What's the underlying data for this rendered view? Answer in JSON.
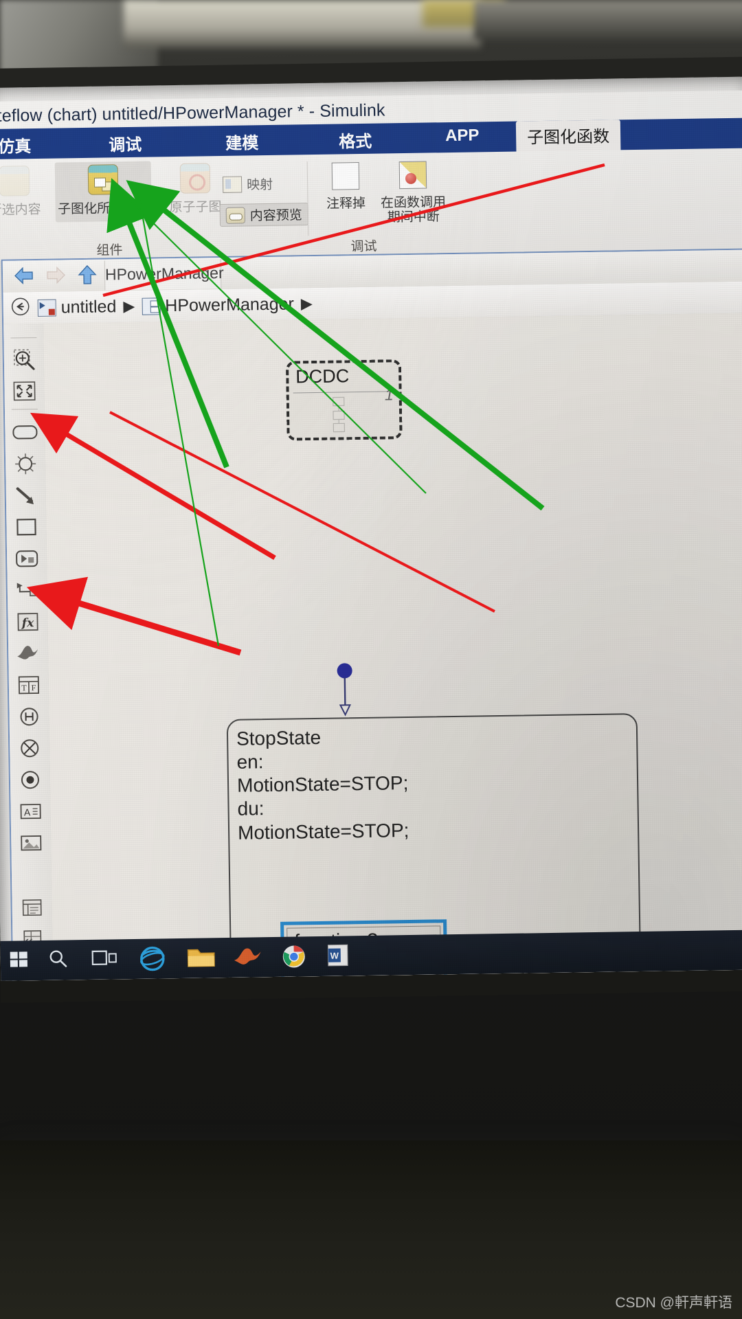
{
  "window": {
    "title": "tateflow (chart) untitled/HPowerManager * - Simulink"
  },
  "ribbon": {
    "tabs": [
      {
        "label": "仿真",
        "active": false
      },
      {
        "label": "调试",
        "active": false
      },
      {
        "label": "建模",
        "active": false
      },
      {
        "label": "格式",
        "active": false
      },
      {
        "label": "APP",
        "active": false
      },
      {
        "label": "子图化函数",
        "active": true
      }
    ],
    "buttons": {
      "uncompose_selected": "所选内容",
      "subchart_selected": "子图化所选内容",
      "atomic_subchart": "原子子图",
      "map": "映射",
      "content_preview": "内容预览",
      "comment_out": "注释掉",
      "break_on_call_l1": "在函数调用",
      "break_on_call_l2": "期间中断"
    },
    "groups": {
      "component": "组件",
      "debug": "调试"
    }
  },
  "model_window": {
    "file_tab": "HPowerManager",
    "breadcrumb": [
      {
        "label": "untitled",
        "icon": "model-icon"
      },
      {
        "label": "HPowerManager",
        "icon": "chart-icon"
      }
    ],
    "breadcrumb_separator": "▶",
    "nav": {
      "back": "back-arrow",
      "forward": "forward-arrow",
      "up": "up-arrow"
    }
  },
  "palette": {
    "items": [
      {
        "name": "zoom-tool",
        "icon": "magnifier-icon"
      },
      {
        "name": "fit-to-view-tool",
        "icon": "fit-to-view-icon"
      },
      {
        "name": "state-tool",
        "icon": "rounded-rect-icon"
      },
      {
        "name": "history-junction-tool",
        "icon": "junction-icon"
      },
      {
        "name": "transition-tool",
        "icon": "arrow-icon"
      },
      {
        "name": "box-tool",
        "icon": "square-icon"
      },
      {
        "name": "graphical-function-tool",
        "icon": "graphical-function-icon"
      },
      {
        "name": "simulink-function-tool",
        "icon": "simulink-function-icon"
      },
      {
        "name": "matlab-function-tool",
        "icon": "fx-icon"
      },
      {
        "name": "simulink-state-tool",
        "icon": "matlab-logo-icon"
      },
      {
        "name": "truth-table-tool",
        "icon": "truth-table-icon"
      },
      {
        "name": "history-tool",
        "icon": "circle-h-icon"
      },
      {
        "name": "terminate-junction-tool",
        "icon": "circle-x-icon"
      },
      {
        "name": "connective-junction-tool",
        "icon": "circle-dot-icon"
      },
      {
        "name": "annotation-tool",
        "icon": "text-a-icon"
      },
      {
        "name": "image-annotation-tool",
        "icon": "image-icon"
      }
    ],
    "bottom_items": [
      {
        "name": "model-explorer",
        "icon": "explorer-icon"
      },
      {
        "name": "symbols-pane",
        "icon": "symbols-icon"
      }
    ],
    "collapse_label": "«"
  },
  "chart": {
    "state": {
      "name": "StopState",
      "label_lines": [
        "StopState",
        "en:",
        "MotionState=STOP;",
        "du:",
        "MotionState=STOP;"
      ]
    },
    "subchart": {
      "name": "DCDC",
      "badge": "1"
    },
    "function_box": {
      "title": "function  ?",
      "close": "×"
    },
    "default_transition": "default-transition"
  },
  "annotations": {
    "red_arrow_count": 2,
    "green_arrow_count": 2,
    "red_color": "#e8191b",
    "green_color": "#16a31c"
  },
  "taskbar": {
    "items": [
      {
        "name": "start-button",
        "icon": "windows-icon"
      },
      {
        "name": "search-button",
        "icon": "search-icon"
      },
      {
        "name": "task-view-button",
        "icon": "task-view-icon"
      },
      {
        "name": "internet-explorer",
        "icon": "ie-icon"
      },
      {
        "name": "file-explorer",
        "icon": "folder-icon"
      },
      {
        "name": "matlab",
        "icon": "matlab-icon"
      },
      {
        "name": "chrome",
        "icon": "chrome-icon"
      },
      {
        "name": "word",
        "icon": "word-icon"
      }
    ]
  },
  "watermark": "CSDN @軒声軒语"
}
